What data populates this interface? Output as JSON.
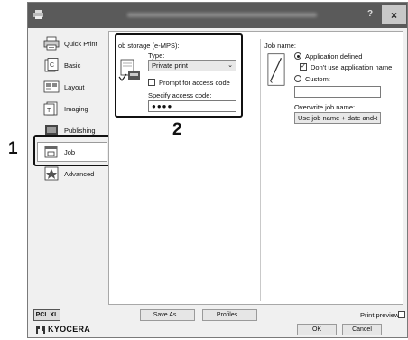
{
  "window": {
    "help_glyph": "?",
    "close_glyph": "×"
  },
  "nav": {
    "items": [
      {
        "label": "Quick Print",
        "icon": "quick-print-icon"
      },
      {
        "label": "Basic",
        "icon": "basic-icon"
      },
      {
        "label": "Layout",
        "icon": "layout-icon"
      },
      {
        "label": "Imaging",
        "icon": "imaging-icon"
      },
      {
        "label": "Publishing",
        "icon": "publishing-icon"
      },
      {
        "label": "Job",
        "icon": "job-icon",
        "selected": true
      },
      {
        "label": "Advanced",
        "icon": "advanced-icon"
      }
    ]
  },
  "job_storage": {
    "title": "ob storage (e-MPS):",
    "type_label": "Type:",
    "type_value": "Private print",
    "prompt_label": "Prompt for access code",
    "prompt_checked": false,
    "access_label": "Specify access code:",
    "access_value": "●●●●"
  },
  "job_name": {
    "title": "Job name:",
    "option_app_defined": "Application defined",
    "app_defined_selected": true,
    "dont_use_label": "Don't use application name",
    "dont_use_checked": true,
    "option_custom": "Custom:",
    "custom_value": "",
    "overwrite_label": "Overwrite job name:",
    "overwrite_value": "Use job name + date and t"
  },
  "footer": {
    "pcl_badge": "PCL XL",
    "save_as": "Save As...",
    "profiles": "Profiles...",
    "print_preview": "Print preview",
    "ok": "OK",
    "cancel": "Cancel",
    "brand": "KYOCERA"
  },
  "callouts": {
    "one": "1",
    "two": "2"
  }
}
